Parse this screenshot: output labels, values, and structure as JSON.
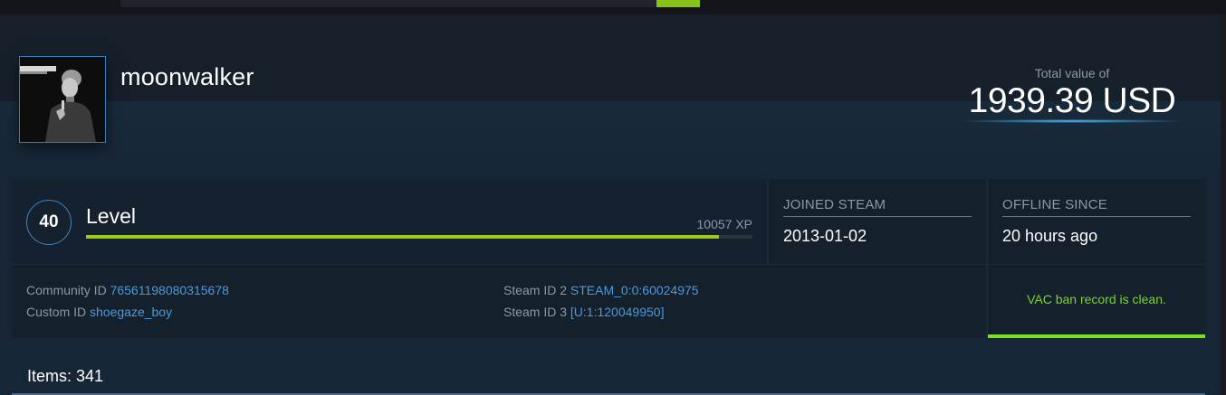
{
  "profile": {
    "username": "moonwalker"
  },
  "total": {
    "label": "Total value of",
    "value": "1939.39 USD"
  },
  "level": {
    "number": "40",
    "label": "Level",
    "xp": "10057 XP",
    "progress_fraction": 0.95
  },
  "joined": {
    "title": "JOINED STEAM",
    "value": "2013-01-02"
  },
  "offline": {
    "title": "OFFLINE SINCE",
    "value": "20 hours ago"
  },
  "ids": {
    "community_label": "Community ID",
    "community_value": "76561198080315678",
    "custom_label": "Custom ID",
    "custom_value": "shoegaze_boy",
    "steam2_label": "Steam ID 2",
    "steam2_value": "STEAM_0:0:60024975",
    "steam3_label": "Steam ID 3",
    "steam3_value": "[U:1:120049950]"
  },
  "vac": {
    "text": "VAC ban record is clean."
  },
  "items": {
    "label": "Items: 341"
  },
  "colors": {
    "accent_green": "#9ccc1a",
    "link_blue": "#4a9ae0",
    "vac_green": "#7bd629"
  }
}
